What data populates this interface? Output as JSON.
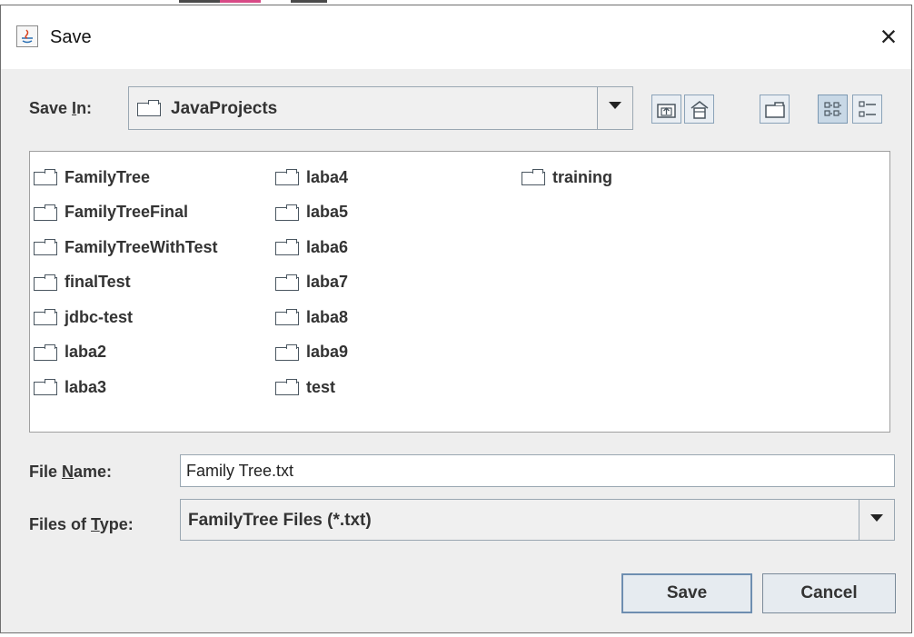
{
  "window": {
    "title": "Save",
    "close_label": "×"
  },
  "save_in": {
    "label_pre": "Save ",
    "label_mnemonic": "I",
    "label_post": "n:",
    "value": "JavaProjects"
  },
  "toolbar": {
    "buttons": [
      {
        "name": "up-one-level-icon",
        "pressed": false
      },
      {
        "name": "home-icon",
        "pressed": false
      },
      {
        "name": "new-folder-icon",
        "pressed": false
      },
      {
        "name": "list-view-icon",
        "pressed": true
      },
      {
        "name": "details-view-icon",
        "pressed": false
      }
    ]
  },
  "files": {
    "columns": [
      [
        "FamilyTree",
        "FamilyTreeFinal",
        "FamilyTreeWithTest",
        "finalTest",
        "jdbc-test",
        "laba2",
        "laba3"
      ],
      [
        "laba4",
        "laba5",
        "laba6",
        "laba7",
        "laba8",
        "laba9",
        "test"
      ],
      [
        "training"
      ]
    ]
  },
  "file_name": {
    "label_pre": "File ",
    "label_mnemonic": "N",
    "label_post": "ame:",
    "value": "Family Tree.txt"
  },
  "file_type": {
    "label_pre": "Files of ",
    "label_mnemonic": "T",
    "label_post": "ype:",
    "value": "FamilyTree Files (*.txt)"
  },
  "buttons": {
    "save": "Save",
    "cancel": "Cancel"
  },
  "colors": {
    "accent_border": "#6e8eb0",
    "selected_toggle": "#c8d8e6"
  }
}
